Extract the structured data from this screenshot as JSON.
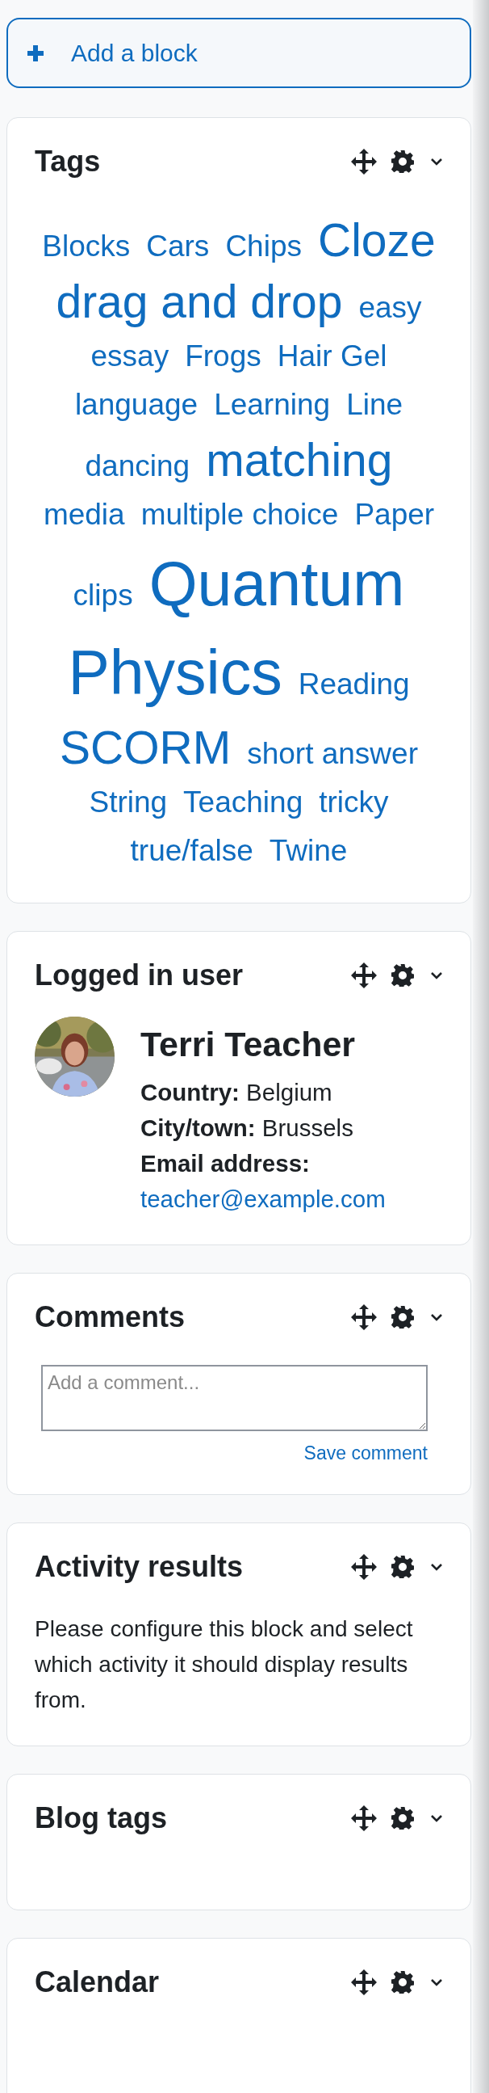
{
  "add_block_button": {
    "label": "Add a block"
  },
  "blocks": [
    {
      "kind": "tags",
      "title": "Tags",
      "tags": [
        {
          "label": "Blocks",
          "kind": "small"
        },
        {
          "label": "Cars",
          "kind": "small"
        },
        {
          "label": "Chips",
          "kind": "small"
        },
        {
          "label": "Cloze",
          "kind": "medium"
        },
        {
          "label": "drag and drop",
          "kind": "medium"
        },
        {
          "label": "easy",
          "kind": "small"
        },
        {
          "label": "essay",
          "kind": "small"
        },
        {
          "label": "Frogs",
          "kind": "small"
        },
        {
          "label": "Hair Gel",
          "kind": "small"
        },
        {
          "label": "language",
          "kind": "small"
        },
        {
          "label": "Learning",
          "kind": "small"
        },
        {
          "label": "Line",
          "kind": "small"
        },
        {
          "label": "dancing",
          "kind": "small"
        },
        {
          "label": "matching",
          "kind": "medium"
        },
        {
          "label": "media",
          "kind": "small"
        },
        {
          "label": "multiple choice",
          "kind": "small"
        },
        {
          "label": "Paper",
          "kind": "small"
        },
        {
          "label": "clips",
          "kind": "small"
        },
        {
          "label": "Quantum",
          "kind": "large"
        },
        {
          "label": "Physics",
          "kind": "large"
        },
        {
          "label": "Reading",
          "kind": "small"
        },
        {
          "label": "SCORM",
          "kind": "medium"
        },
        {
          "label": "short answer",
          "kind": "small"
        },
        {
          "label": "String",
          "kind": "small"
        },
        {
          "label": "Teaching",
          "kind": "small"
        },
        {
          "label": "tricky",
          "kind": "small"
        },
        {
          "label": "true/false",
          "kind": "small"
        },
        {
          "label": "Twine",
          "kind": "small"
        }
      ]
    },
    {
      "kind": "user",
      "title": "Logged in user",
      "name": "Terri Teacher",
      "fields": [
        {
          "label": "Country:",
          "value": "Belgium",
          "kind": "inline"
        },
        {
          "label": "City/town:",
          "value": "Brussels",
          "kind": "inline"
        },
        {
          "label": "Email address:",
          "value": "teacher@example.com",
          "kind": "link"
        }
      ]
    },
    {
      "kind": "comments",
      "title": "Comments",
      "placeholder": "Add a comment...",
      "action": "Save comment"
    },
    {
      "kind": "text",
      "title": "Activity results",
      "text": "Please configure this block and select which activity it should display results from."
    },
    {
      "kind": "empty",
      "title": "Blog tags"
    },
    {
      "kind": "cut",
      "title": "Calendar"
    }
  ]
}
